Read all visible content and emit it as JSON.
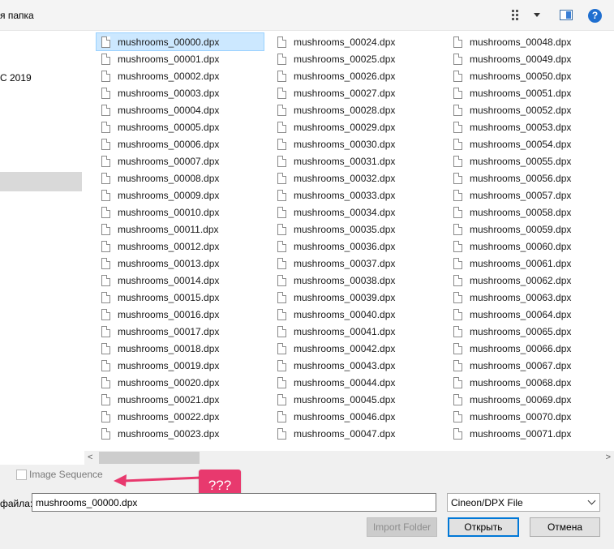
{
  "toolbar": {
    "new_folder_label": "я папка",
    "help_label": "?"
  },
  "nav": {
    "items": [
      "C 2019"
    ]
  },
  "files": {
    "columns": [
      [
        "mushrooms_00000.dpx",
        "mushrooms_00001.dpx",
        "mushrooms_00002.dpx",
        "mushrooms_00003.dpx",
        "mushrooms_00004.dpx",
        "mushrooms_00005.dpx",
        "mushrooms_00006.dpx",
        "mushrooms_00007.dpx",
        "mushrooms_00008.dpx",
        "mushrooms_00009.dpx",
        "mushrooms_00010.dpx",
        "mushrooms_00011.dpx",
        "mushrooms_00012.dpx",
        "mushrooms_00013.dpx",
        "mushrooms_00014.dpx",
        "mushrooms_00015.dpx",
        "mushrooms_00016.dpx",
        "mushrooms_00017.dpx",
        "mushrooms_00018.dpx",
        "mushrooms_00019.dpx",
        "mushrooms_00020.dpx",
        "mushrooms_00021.dpx",
        "mushrooms_00022.dpx",
        "mushrooms_00023.dpx"
      ],
      [
        "mushrooms_00024.dpx",
        "mushrooms_00025.dpx",
        "mushrooms_00026.dpx",
        "mushrooms_00027.dpx",
        "mushrooms_00028.dpx",
        "mushrooms_00029.dpx",
        "mushrooms_00030.dpx",
        "mushrooms_00031.dpx",
        "mushrooms_00032.dpx",
        "mushrooms_00033.dpx",
        "mushrooms_00034.dpx",
        "mushrooms_00035.dpx",
        "mushrooms_00036.dpx",
        "mushrooms_00037.dpx",
        "mushrooms_00038.dpx",
        "mushrooms_00039.dpx",
        "mushrooms_00040.dpx",
        "mushrooms_00041.dpx",
        "mushrooms_00042.dpx",
        "mushrooms_00043.dpx",
        "mushrooms_00044.dpx",
        "mushrooms_00045.dpx",
        "mushrooms_00046.dpx",
        "mushrooms_00047.dpx"
      ],
      [
        "mushrooms_00048.dpx",
        "mushrooms_00049.dpx",
        "mushrooms_00050.dpx",
        "mushrooms_00051.dpx",
        "mushrooms_00052.dpx",
        "mushrooms_00053.dpx",
        "mushrooms_00054.dpx",
        "mushrooms_00055.dpx",
        "mushrooms_00056.dpx",
        "mushrooms_00057.dpx",
        "mushrooms_00058.dpx",
        "mushrooms_00059.dpx",
        "mushrooms_00060.dpx",
        "mushrooms_00061.dpx",
        "mushrooms_00062.dpx",
        "mushrooms_00063.dpx",
        "mushrooms_00064.dpx",
        "mushrooms_00065.dpx",
        "mushrooms_00066.dpx",
        "mushrooms_00067.dpx",
        "mushrooms_00068.dpx",
        "mushrooms_00069.dpx",
        "mushrooms_00070.dpx",
        "mushrooms_00071.dpx"
      ]
    ],
    "selected": "mushrooms_00000.dpx",
    "icon": "file-icon"
  },
  "scrollbar": {
    "left_arrow": "<",
    "right_arrow": ">"
  },
  "options": {
    "image_sequence_label": "Image Sequence",
    "image_sequence_checked": false
  },
  "annotation": {
    "callout_text": "???",
    "color": "#e8396e"
  },
  "footer": {
    "filename_label": "файла:",
    "filename_value": "mushrooms_00000.dpx",
    "filetype_value": "Cineon/DPX File",
    "import_folder_label": "Import Folder",
    "open_label": "Открыть",
    "cancel_label": "Отмена"
  }
}
